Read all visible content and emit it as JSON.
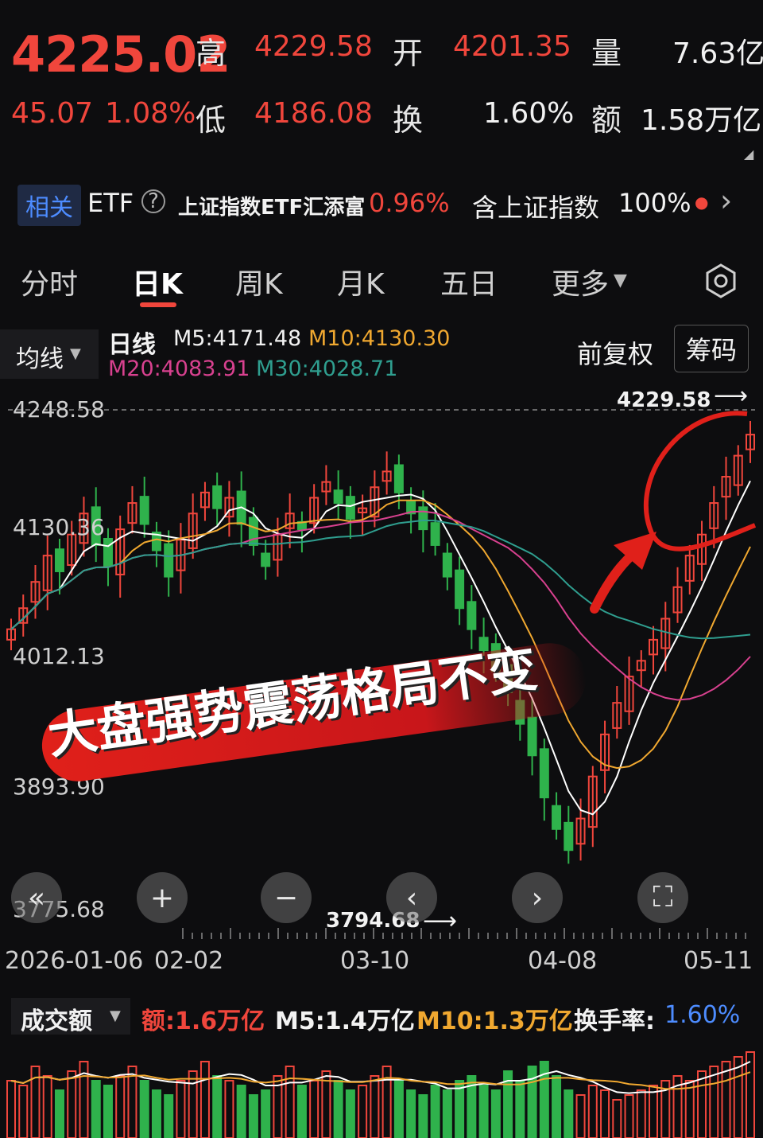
{
  "quote": {
    "price": "4225.02",
    "change": "45.07",
    "change_pct": "1.08%",
    "high_label": "高",
    "high": "4229.58",
    "open_label": "开",
    "open": "4201.35",
    "volume_label": "量",
    "volume": "7.63亿",
    "low_label": "低",
    "low": "4186.08",
    "turnover_label": "换",
    "turnover": "1.60%",
    "amount_label": "额",
    "amount": "1.58万亿"
  },
  "etf": {
    "badge": "相关",
    "label": "ETF",
    "name": "上证指数ETF汇添富",
    "change": "0.96%",
    "contains_label": "含上证指数",
    "contains_value": "100%"
  },
  "tabs": [
    "分时",
    "日K",
    "周K",
    "月K",
    "五日",
    "更多"
  ],
  "active_tab": "日K",
  "indicator": {
    "selector": "均线",
    "period": "日线",
    "m5": "M5:4171.48",
    "m10": "M10:4130.30",
    "m20": "M20:4083.91",
    "m30": "M30:4028.71",
    "adjust": "前复权",
    "chips": "筹码"
  },
  "chart_data": {
    "type": "candlestick",
    "y_ticks": [
      "4248.58",
      "4130.36",
      "4012.13",
      "3893.90",
      "3775.68"
    ],
    "ylim": [
      3775.68,
      4248.58
    ],
    "high_marker": "4229.58",
    "low_marker": "3794.68",
    "x_ticks": [
      "2026-01-06",
      "02-02",
      "03-10",
      "04-08",
      "05-11"
    ],
    "closes": [
      4040,
      4060,
      4085,
      4110,
      4095,
      4130,
      4150,
      4120,
      4100,
      4135,
      4160,
      4140,
      4115,
      4090,
      4125,
      4150,
      4170,
      4155,
      4165,
      4140,
      4120,
      4100,
      4130,
      4150,
      4135,
      4165,
      4180,
      4160,
      4145,
      4155,
      4175,
      4190,
      4170,
      4150,
      4135,
      4120,
      4090,
      4060,
      4040,
      4020,
      4000,
      3980,
      3950,
      3920,
      3880,
      3850,
      3830,
      3860,
      3900,
      3940,
      3970,
      3995,
      4010,
      4030,
      4050,
      4080,
      4110,
      4130,
      4160,
      4185,
      4205,
      4225.02
    ],
    "banner": "大盘强势震荡格局不变",
    "colors": {
      "up": "#f0463c",
      "down": "#2fb24c",
      "m5": "#ffffff",
      "m10": "#f0a830",
      "m20": "#d8418f",
      "m30": "#2f9e8f"
    }
  },
  "volume_panel": {
    "selector": "成交额",
    "amount": "额:1.6万亿",
    "m5": "M5:1.4万亿",
    "m10": "M10:1.3万亿",
    "turnover_label": "换手率:",
    "turnover": "1.60%",
    "values": [
      1.2,
      1.1,
      1.5,
      1.3,
      1.0,
      1.4,
      1.6,
      1.2,
      1.1,
      1.3,
      1.5,
      1.2,
      1.0,
      0.9,
      1.2,
      1.4,
      1.6,
      1.3,
      1.2,
      1.1,
      0.9,
      1.0,
      1.3,
      1.5,
      1.1,
      1.2,
      1.4,
      1.2,
      1.0,
      1.1,
      1.3,
      1.5,
      1.2,
      1.0,
      0.9,
      1.1,
      1.0,
      1.2,
      1.3,
      1.1,
      1.0,
      1.4,
      1.2,
      1.5,
      1.6,
      1.3,
      1.0,
      0.9,
      1.1,
      1.0,
      0.8,
      0.9,
      1.0,
      1.1,
      1.2,
      1.3,
      1.2,
      1.4,
      1.5,
      1.6,
      1.7,
      1.8
    ]
  }
}
